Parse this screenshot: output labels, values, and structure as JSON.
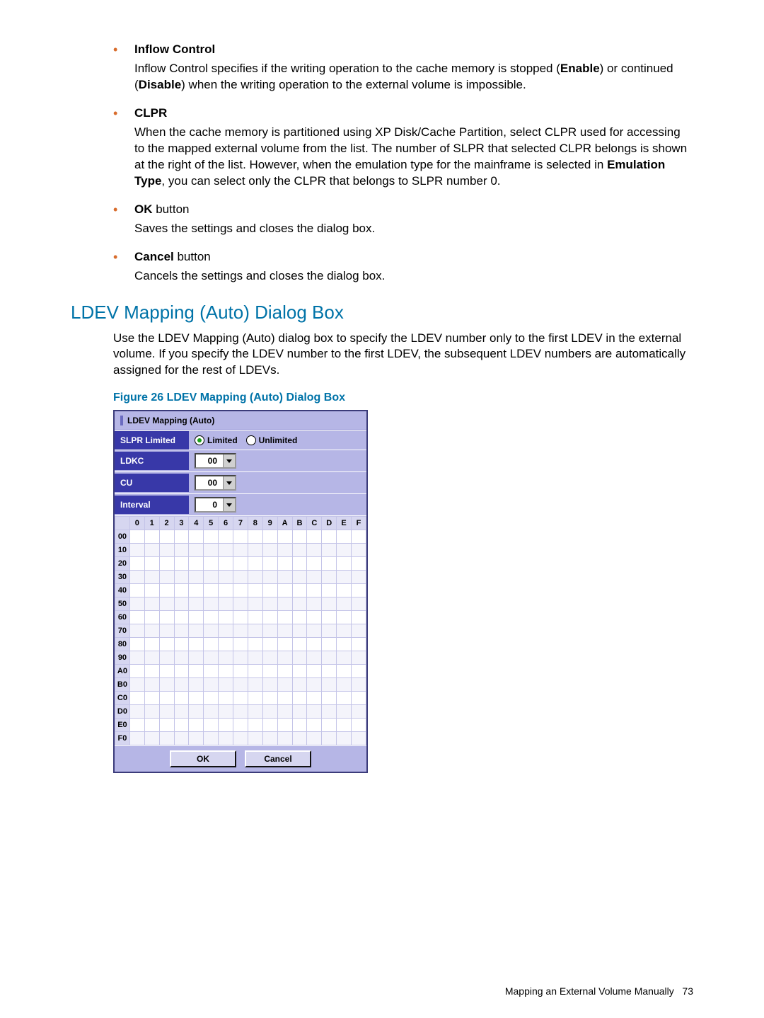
{
  "items": [
    {
      "title": "Inflow Control",
      "title_suffix": "",
      "body_pre": "Inflow Control specifies if the writing operation to the cache memory is stopped (",
      "bold1": "Enable",
      "mid": ") or continued (",
      "bold2": "Disable",
      "body_post": ") when the writing operation to the external volume is impossible."
    },
    {
      "title": "CLPR",
      "title_suffix": "",
      "body_pre": "When the cache memory is partitioned using XP Disk/Cache Partition, select CLPR used for accessing to the mapped external volume from the list. The number of SLPR that selected CLPR belongs is shown at the right of the list. However, when the emulation type for the mainframe is selected in ",
      "bold1": "Emulation Type",
      "mid": ", you can select only the CLPR that belongs to SLPR number 0.",
      "bold2": "",
      "body_post": ""
    },
    {
      "title": "OK",
      "title_suffix": " button",
      "body_pre": "Saves the settings and closes the dialog box.",
      "bold1": "",
      "mid": "",
      "bold2": "",
      "body_post": ""
    },
    {
      "title": "Cancel",
      "title_suffix": " button",
      "body_pre": "Cancels the settings and closes the dialog box.",
      "bold1": "",
      "mid": "",
      "bold2": "",
      "body_post": ""
    }
  ],
  "section_heading": "LDEV Mapping (Auto) Dialog Box",
  "section_para": "Use the LDEV Mapping (Auto) dialog box to specify the LDEV number only to the first LDEV in the external volume. If you specify the LDEV number to the first LDEV, the subsequent LDEV numbers are automatically assigned for the rest of LDEVs.",
  "figure_caption": "Figure 26 LDEV Mapping (Auto) Dialog Box",
  "dialog": {
    "title": "LDEV Mapping (Auto)",
    "slpr_label": "SLPR Limited",
    "radio_limited": "Limited",
    "radio_unlimited": "Unlimited",
    "ldkc_label": "LDKC",
    "ldkc_value": "00",
    "cu_label": "CU",
    "cu_value": "00",
    "interval_label": "Interval",
    "interval_value": "0",
    "cols": [
      "0",
      "1",
      "2",
      "3",
      "4",
      "5",
      "6",
      "7",
      "8",
      "9",
      "A",
      "B",
      "C",
      "D",
      "E",
      "F"
    ],
    "rows": [
      "00",
      "10",
      "20",
      "30",
      "40",
      "50",
      "60",
      "70",
      "80",
      "90",
      "A0",
      "B0",
      "C0",
      "D0",
      "E0",
      "F0"
    ],
    "ok": "OK",
    "cancel": "Cancel"
  },
  "footer": {
    "text": "Mapping an External Volume Manually",
    "page": "73"
  }
}
